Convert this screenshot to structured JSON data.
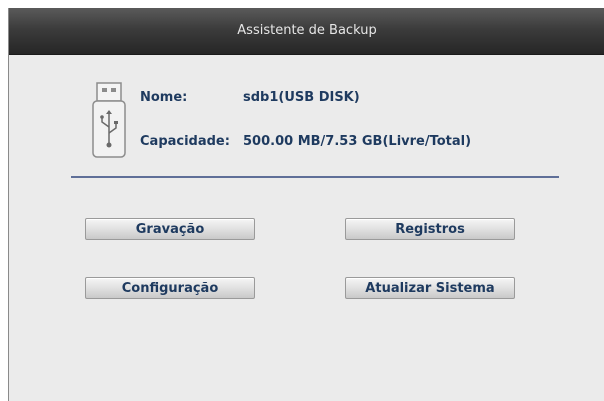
{
  "dialog": {
    "title": "Assistente de Backup"
  },
  "device": {
    "icon": "usb-drive-icon",
    "name_label": "Nome:",
    "name_value": "sdb1(USB DISK)",
    "capacity_label": "Capacidade:",
    "capacity_value": "500.00 MB/7.53 GB(Livre/Total)"
  },
  "buttons": {
    "recording": "Gravação",
    "logs": "Registros",
    "configuration": "Configuração",
    "update_system": "Atualizar Sistema"
  },
  "colors": {
    "text": "#1e3a5f",
    "divider": "#5f6f98",
    "titlebar": "#3c3c3c",
    "background": "#ebebeb"
  }
}
